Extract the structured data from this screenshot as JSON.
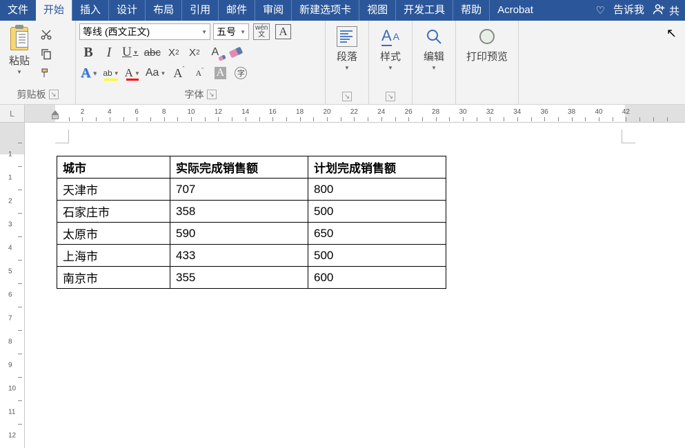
{
  "tabs": {
    "file": "文件",
    "home": "开始",
    "insert": "插入",
    "design": "设计",
    "layout": "布局",
    "references": "引用",
    "mailings": "邮件",
    "review": "审阅",
    "newtab": "新建选项卡",
    "view": "视图",
    "developer": "开发工具",
    "help": "帮助",
    "acrobat": "Acrobat",
    "tellme": "告诉我",
    "share": "共"
  },
  "clipboard": {
    "paste": "粘贴",
    "group": "剪贴板"
  },
  "font": {
    "name_value": "等线 (西文正文)",
    "size_value": "五号",
    "wen_top": "wén",
    "wen_bot": "文",
    "boxA": "A",
    "group": "字体",
    "abc": "abc",
    "Aa": "Aa",
    "circChar": "字"
  },
  "groups": {
    "paragraph": "段落",
    "styles": "样式",
    "editing": "编辑",
    "printpreview": "打印预览"
  },
  "table": {
    "headers": [
      "城市",
      "实际完成销售额",
      "计划完成销售额"
    ],
    "rows": [
      [
        "天津市",
        "707",
        "800"
      ],
      [
        "石家庄市",
        "358",
        "500"
      ],
      [
        "太原市",
        "590",
        "650"
      ],
      [
        "上海市",
        "433",
        "500"
      ],
      [
        "南京市",
        "355",
        "600"
      ]
    ]
  },
  "ruler_nums": [
    2,
    4,
    6,
    8,
    10,
    12,
    14,
    16,
    18,
    20,
    22,
    24,
    26,
    28,
    30,
    32,
    34,
    36,
    38,
    40,
    42
  ],
  "vruler_nums": [
    1,
    1,
    2,
    3,
    4,
    5,
    6,
    7,
    8,
    9,
    10,
    11,
    12
  ]
}
